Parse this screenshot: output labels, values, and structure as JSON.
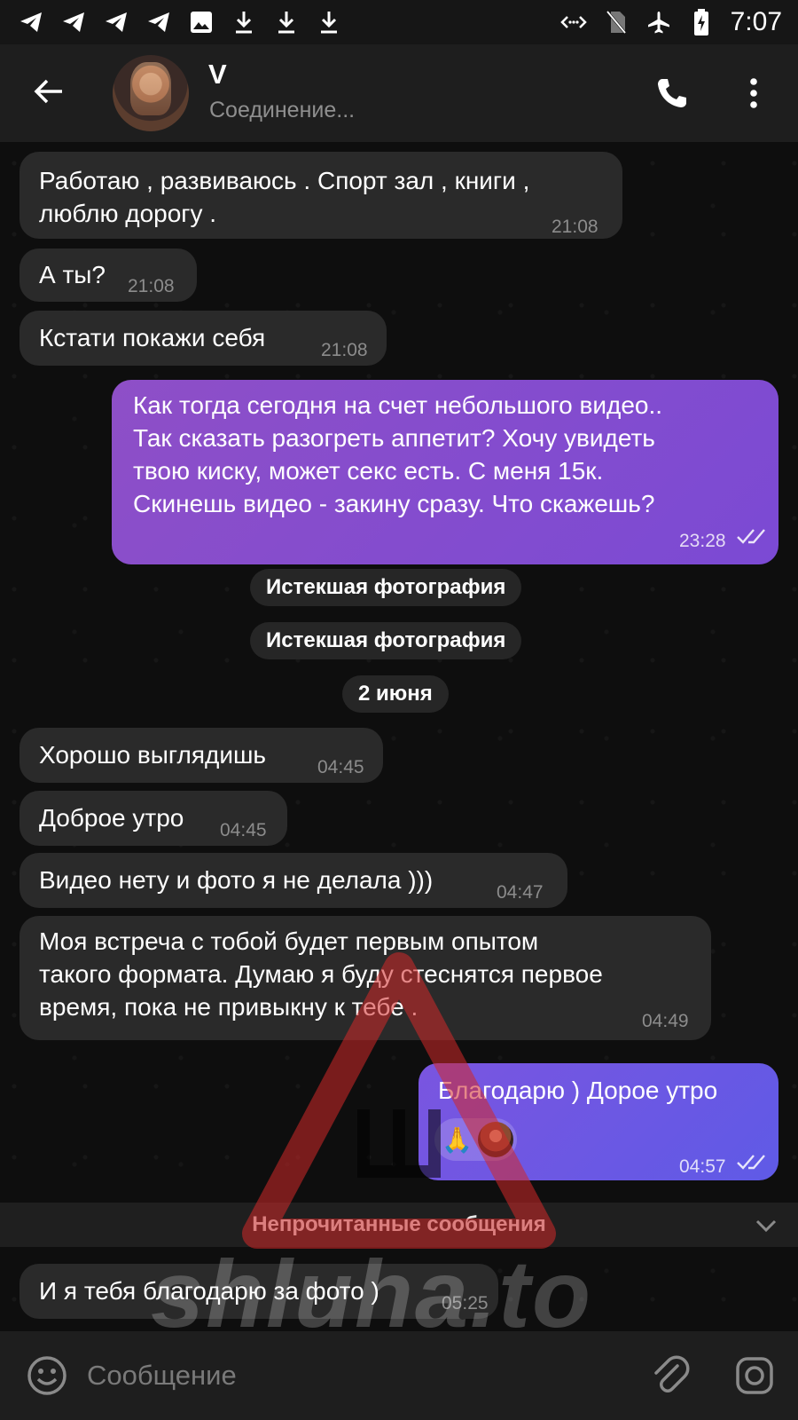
{
  "status_bar": {
    "time": "7:07",
    "left_icons": [
      "telegram-icon",
      "telegram-icon",
      "telegram-icon",
      "telegram-icon",
      "image-icon",
      "download-icon",
      "download-icon",
      "download-icon"
    ],
    "right_icons": [
      "data-saver-icon",
      "no-sim-icon",
      "airplane-icon",
      "battery-charging-icon"
    ]
  },
  "header": {
    "name": "V",
    "status": "Соединение..."
  },
  "messages": [
    {
      "text": "Работаю , развиваюсь . Спорт зал , книги ,\nлюблю дорогу .",
      "time": "21:08",
      "direction": "in"
    },
    {
      "text": "А ты?",
      "time": "21:08",
      "direction": "in"
    },
    {
      "text": "Кстати покажи себя",
      "time": "21:08",
      "direction": "in"
    },
    {
      "text": "Как тогда сегодня на счет небольшого видео..\nТак сказать разогреть аппетит? Хочу увидеть\nтвою киску, может секс есть. С меня 15к.\nСкинешь видео - закину сразу. Что скажешь?",
      "time": "23:28",
      "direction": "out"
    },
    {
      "text": "Хорошо выглядишь",
      "time": "04:45",
      "direction": "in"
    },
    {
      "text": "Доброе утро",
      "time": "04:45",
      "direction": "in"
    },
    {
      "text": "Видео нету и фото я не делала )))",
      "time": "04:47",
      "direction": "in"
    },
    {
      "text": "Моя встреча с тобой будет первым опытом\nтакого формата. Думаю я буду стеснятся первое\nвремя, пока не привыкну к тебе .",
      "time": "04:49",
      "direction": "in"
    },
    {
      "text": "Благодарю ) Дорое утро",
      "time": "04:57",
      "direction": "out",
      "reaction": "🙏"
    },
    {
      "text": "И я тебя благодарю за фото )",
      "time": "05:25",
      "direction": "in"
    }
  ],
  "service_messages": [
    {
      "text": "Истекшая фотография"
    },
    {
      "text": "Истекшая фотография"
    },
    {
      "text": "2 июня"
    }
  ],
  "unread_divider": "Непрочитанные сообщения",
  "watermark": "shluha.to",
  "input": {
    "placeholder": "Сообщение"
  },
  "colors": {
    "incoming_bubble": "#2a2a2a",
    "outgoing_bubble": "#8e4fc7",
    "outgoing_bubble_2": "#6a57e3",
    "header_bg": "#1e1e1e",
    "chat_bg": "#0e0e0e"
  }
}
